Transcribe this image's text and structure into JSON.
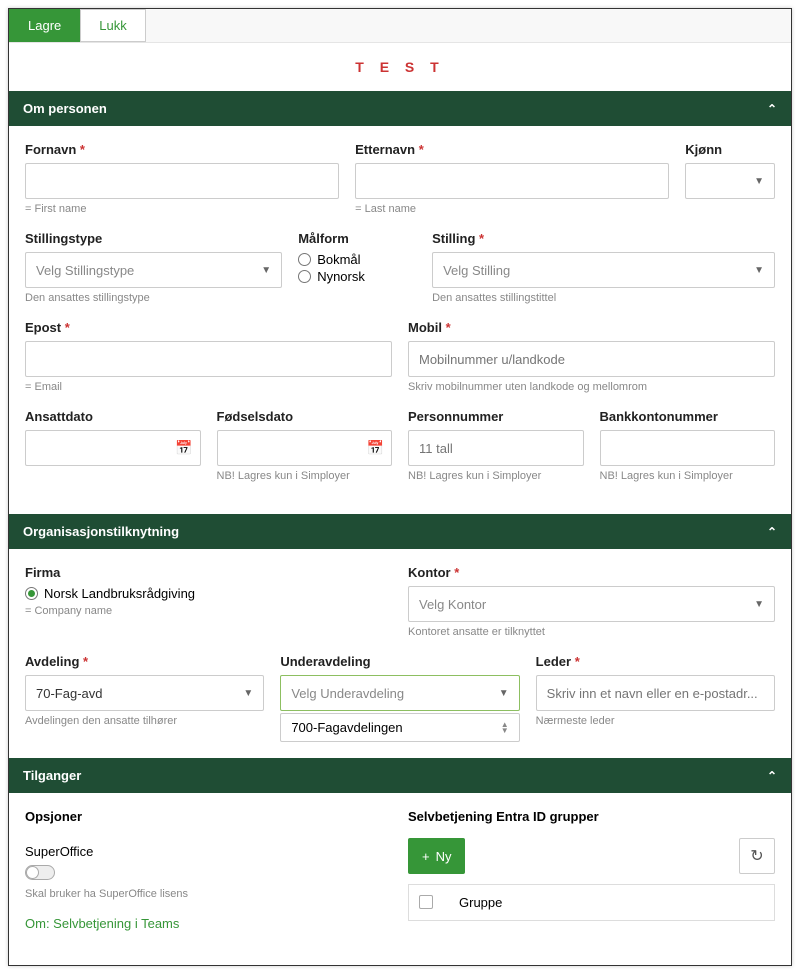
{
  "toolbar": {
    "save": "Lagre",
    "close": "Lukk"
  },
  "title": "T E S T",
  "sections": {
    "person": {
      "header": "Om personen",
      "firstname": {
        "label": "Fornavn",
        "help": "= First name"
      },
      "lastname": {
        "label": "Etternavn",
        "help": "= Last name"
      },
      "gender": {
        "label": "Kjønn"
      },
      "jobtype": {
        "label": "Stillingstype",
        "placeholder": "Velg Stillingstype",
        "help": "Den ansattes stillingstype"
      },
      "language": {
        "label": "Målform",
        "opt1": "Bokmål",
        "opt2": "Nynorsk"
      },
      "position": {
        "label": "Stilling",
        "placeholder": "Velg Stilling",
        "help": "Den ansattes stillingstittel"
      },
      "email": {
        "label": "Epost",
        "help": "= Email"
      },
      "mobile": {
        "label": "Mobil",
        "placeholder": "Mobilnummer u/landkode",
        "help": "Skriv mobilnummer uten landkode og mellomrom"
      },
      "hiredate": {
        "label": "Ansattdato"
      },
      "birthdate": {
        "label": "Fødselsdato",
        "help": "NB! Lagres kun i Simployer"
      },
      "ssn": {
        "label": "Personnummer",
        "placeholder": "11 tall",
        "help": "NB! Lagres kun i Simployer"
      },
      "bank": {
        "label": "Bankkontonummer",
        "help": "NB! Lagres kun i Simployer"
      }
    },
    "org": {
      "header": "Organisasjonstilknytning",
      "company": {
        "label": "Firma",
        "value": "Norsk Landbruksrådgiving",
        "help": "= Company name"
      },
      "office": {
        "label": "Kontor",
        "placeholder": "Velg Kontor",
        "help": "Kontoret ansatte er tilknyttet"
      },
      "dept": {
        "label": "Avdeling",
        "value": "70-Fag-avd",
        "help": "Avdelingen den ansatte tilhører"
      },
      "subdept": {
        "label": "Underavdeling",
        "placeholder": "Velg Underavdeling",
        "option": "700-Fagavdelingen"
      },
      "manager": {
        "label": "Leder",
        "placeholder": "Skriv inn et navn eller en e-postadr...",
        "help": "Nærmeste leder"
      }
    },
    "access": {
      "header": "Tilganger",
      "options": {
        "label": "Opsjoner",
        "so_label": "SuperOffice",
        "so_help": "Skal bruker ha SuperOffice lisens",
        "teams_link": "Om: Selvbetjening i Teams"
      },
      "entra": {
        "label": "Selvbetjening Entra ID grupper",
        "new": "Ny",
        "col": "Gruppe"
      }
    }
  }
}
